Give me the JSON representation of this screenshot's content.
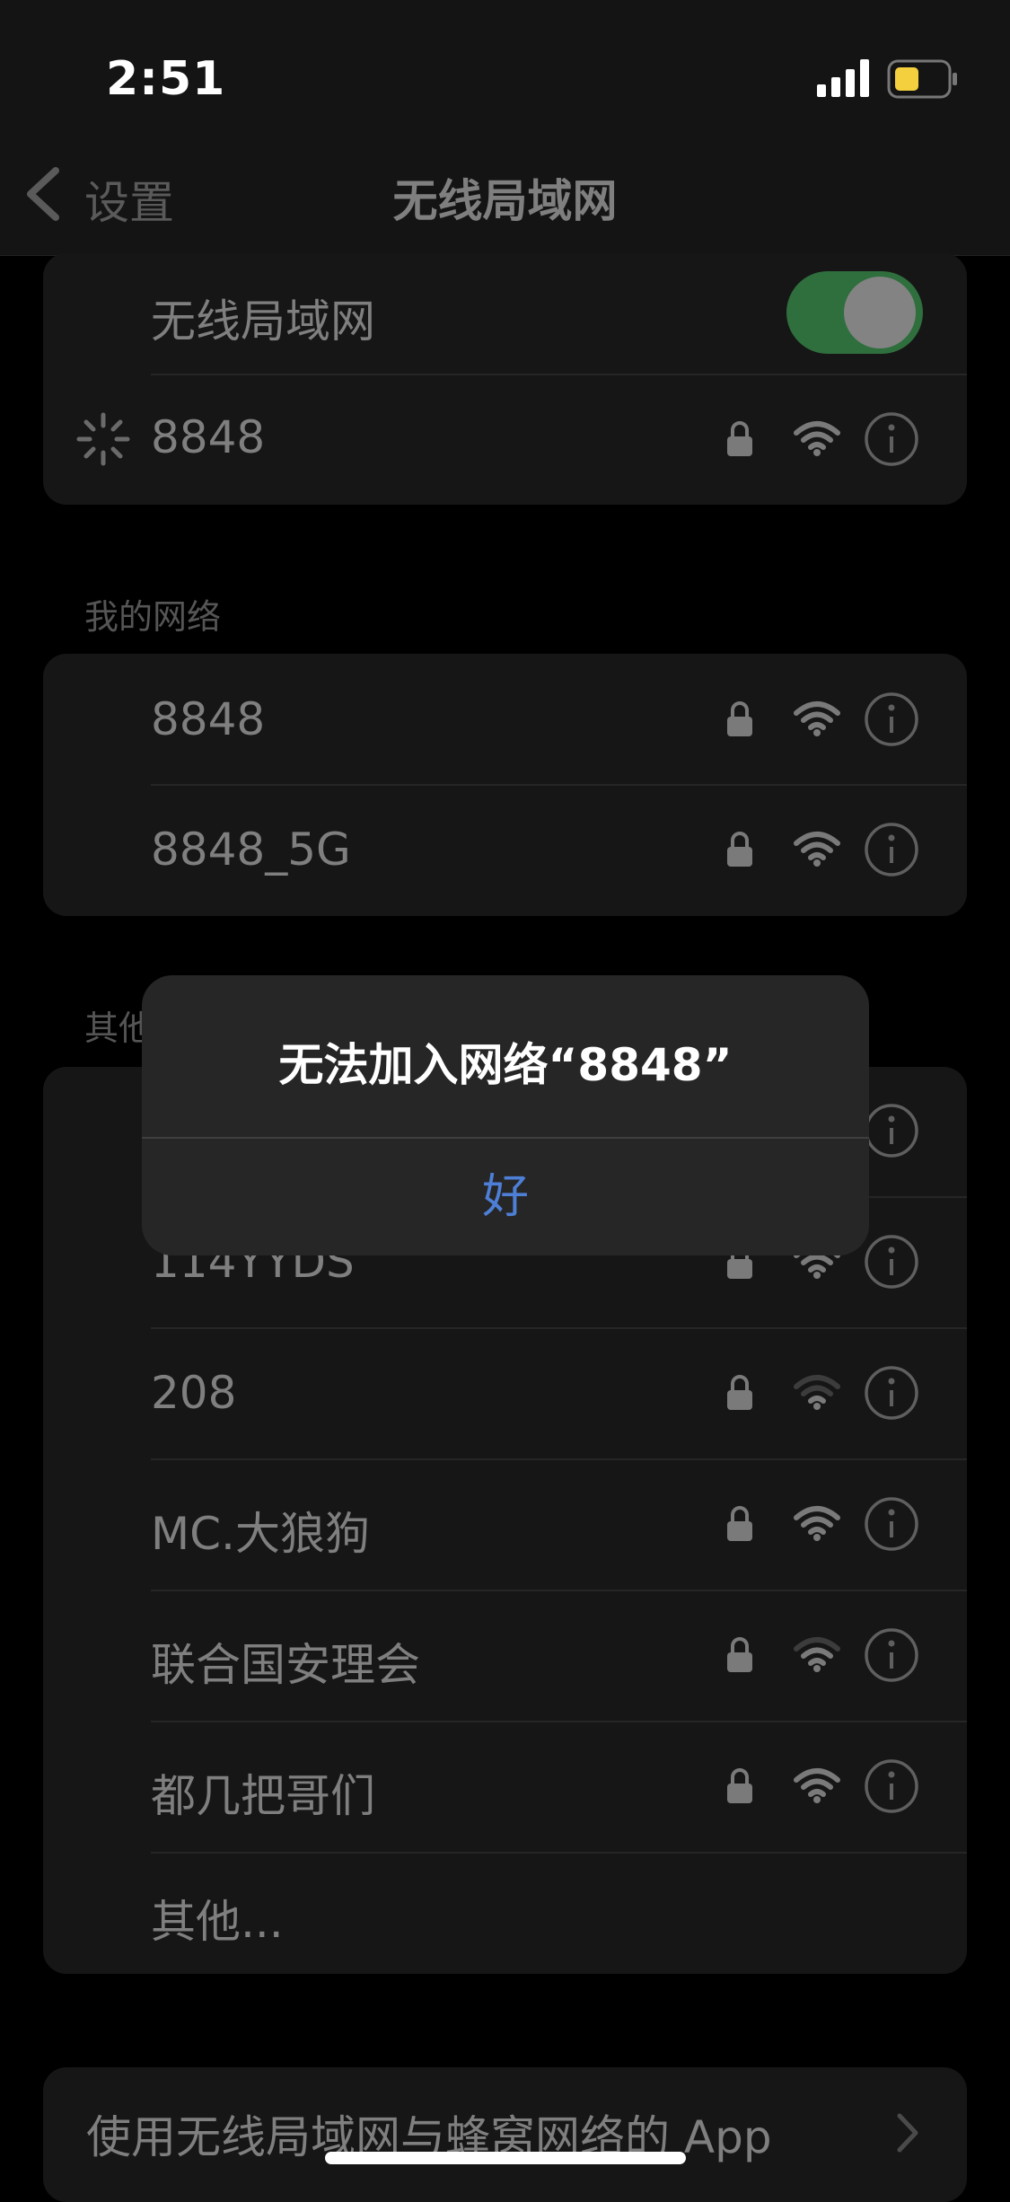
{
  "status_bar": {
    "time": "2:51"
  },
  "nav": {
    "back_label": "设置",
    "title": "无线局域网"
  },
  "wifi_toggle": {
    "label": "无线局域网",
    "on": true
  },
  "current_network": {
    "name": "8848",
    "status": "connecting"
  },
  "my_networks": {
    "header": "我的网络",
    "items": [
      {
        "name": "8848",
        "secured": true
      },
      {
        "name": "8848_5G",
        "secured": true
      }
    ]
  },
  "other_networks": {
    "header": "其他网络",
    "items": [
      {
        "name": "",
        "secured": true
      },
      {
        "name": "114YYDS",
        "secured": true
      },
      {
        "name": "208",
        "secured": true
      },
      {
        "name": "MC.大狼狗",
        "secured": true
      },
      {
        "name": "联合国安理会",
        "secured": true
      },
      {
        "name": "都几把哥们",
        "secured": true
      }
    ],
    "other_label": "其他..."
  },
  "apps_row": {
    "label": "使用无线局域网与蜂窝网络的 App"
  },
  "alert": {
    "title": "无法加入网络“8848”",
    "ok_label": "好"
  },
  "colors": {
    "toggle_on": "#2f6e3d",
    "alert_button": "#4d7fd6",
    "background": "#000000"
  }
}
